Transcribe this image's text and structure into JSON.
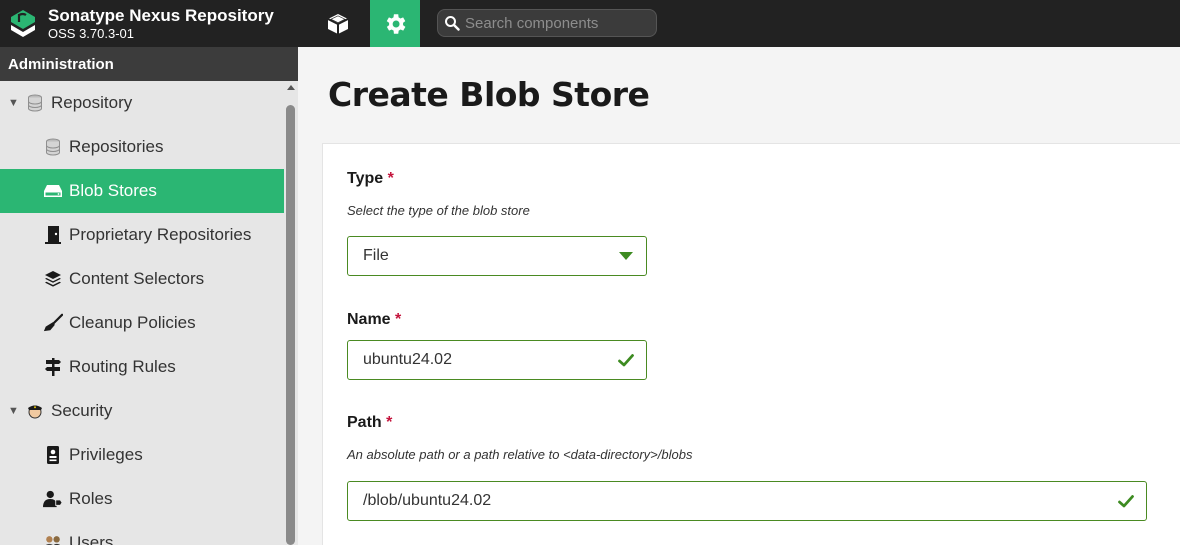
{
  "app": {
    "title": "Sonatype Nexus Repository",
    "version": "OSS 3.70.3-01"
  },
  "nav": {
    "browse_icon": "cube-icon",
    "admin_icon": "gear-icon"
  },
  "search": {
    "placeholder": "Search components"
  },
  "sidebar": {
    "header": "Administration",
    "items": [
      {
        "label": "Repository",
        "icon": "database-icon",
        "level": 0,
        "expanded": true
      },
      {
        "label": "Repositories",
        "icon": "database-icon",
        "level": 1
      },
      {
        "label": "Blob Stores",
        "icon": "hdd-icon",
        "level": 1,
        "active": true
      },
      {
        "label": "Proprietary Repositories",
        "icon": "door-icon",
        "level": 1
      },
      {
        "label": "Content Selectors",
        "icon": "layers-icon",
        "level": 1
      },
      {
        "label": "Cleanup Policies",
        "icon": "broom-icon",
        "level": 1
      },
      {
        "label": "Routing Rules",
        "icon": "signpost-icon",
        "level": 1
      },
      {
        "label": "Security",
        "icon": "police-icon",
        "level": 0,
        "expanded": true
      },
      {
        "label": "Privileges",
        "icon": "id-badge-icon",
        "level": 1
      },
      {
        "label": "Roles",
        "icon": "user-tag-icon",
        "level": 1
      },
      {
        "label": "Users",
        "icon": "users-icon",
        "level": 1
      }
    ]
  },
  "page": {
    "title": "Create Blob Store"
  },
  "form": {
    "type": {
      "label": "Type",
      "required_mark": "*",
      "help": "Select the type of the blob store",
      "value": "File"
    },
    "name": {
      "label": "Name",
      "required_mark": "*",
      "value": "ubuntu24.02"
    },
    "path": {
      "label": "Path",
      "required_mark": "*",
      "help": "An absolute path or a path relative to <data-directory>/blobs",
      "value": "/blob/ubuntu24.02"
    }
  },
  "colors": {
    "accent": "#2bb673",
    "topbar": "#222222",
    "sidebar_header": "#3c3c3c",
    "valid": "#3d8b21",
    "required": "#c4143c"
  }
}
